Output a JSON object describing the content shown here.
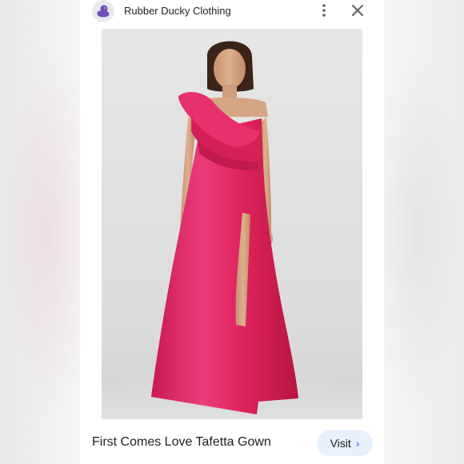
{
  "store": {
    "name": "Rubber Ducky Clothing",
    "avatar_icon": "duck-logo-icon"
  },
  "header": {
    "more_icon": "more-vert-icon",
    "close_icon": "close-icon"
  },
  "product": {
    "title": "First Comes Love Tafetta Gown",
    "image_icon": "product-photo"
  },
  "actions": {
    "visit_label": "Visit",
    "visit_icon": "chevron-right-icon"
  },
  "colors": {
    "accent": "#1a73e8",
    "button_bg": "#e8f0fe",
    "dress": "#e0245e"
  }
}
